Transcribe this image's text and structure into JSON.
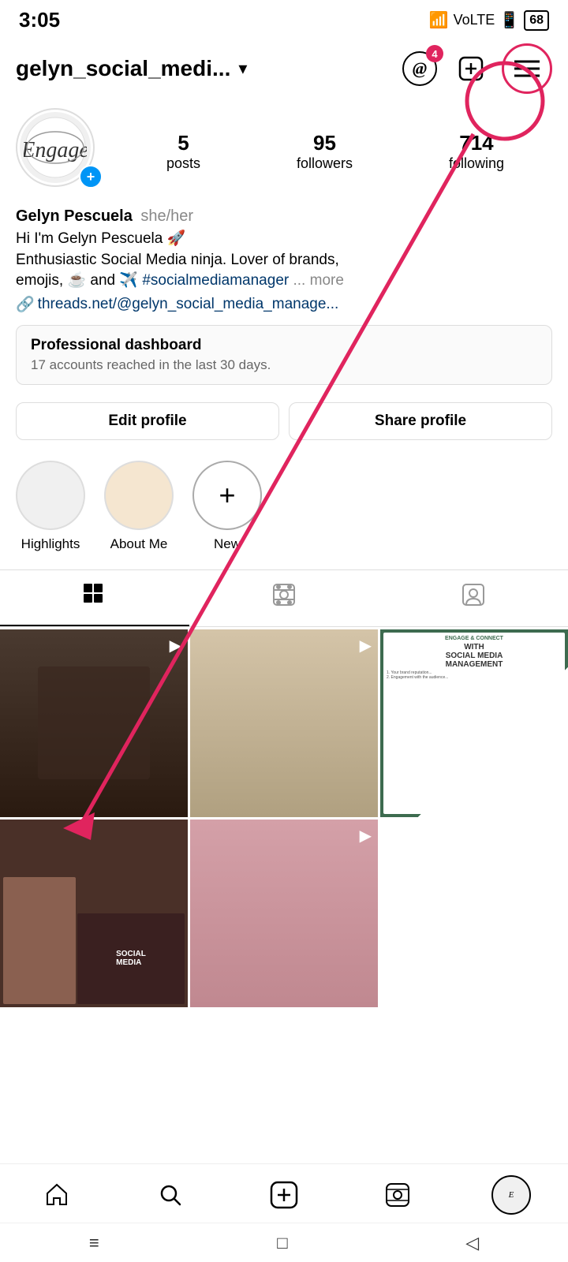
{
  "statusBar": {
    "time": "3:05",
    "batteryLevel": "68"
  },
  "header": {
    "username": "gelyn_social_medi...",
    "chevron": "▾"
  },
  "profile": {
    "displayName": "Gelyn Pescuela",
    "pronouns": "she/her",
    "bioLine1": "Hi I'm Gelyn Pescuela 🚀",
    "bioLine2": "Enthusiastic Social Media ninja. Lover of brands,",
    "bioLine3": "emojis, ☕ and ✈️",
    "hashtag": "#socialmediamanager",
    "bioMore": "... more",
    "link": "threads.net/@gelyn_social_media_manage...",
    "stats": {
      "posts": {
        "count": "5",
        "label": "posts"
      },
      "followers": {
        "count": "95",
        "label": "followers"
      },
      "following": {
        "count": "714",
        "label": "following"
      }
    }
  },
  "dashboard": {
    "title": "Professional dashboard",
    "subtitle": "17 accounts reached in the last 30 days."
  },
  "buttons": {
    "editProfile": "Edit profile",
    "shareProfile": "Share profile"
  },
  "highlights": [
    {
      "label": "Highlights",
      "style": "gray"
    },
    {
      "label": "About Me",
      "style": "cream"
    },
    {
      "label": "New",
      "style": "new"
    }
  ],
  "tabs": [
    {
      "label": "grid-icon",
      "active": true
    },
    {
      "label": "reel-icon",
      "active": false
    },
    {
      "label": "tagged-icon",
      "active": false
    }
  ],
  "nav": {
    "home": "⌂",
    "search": "🔍",
    "add": "⊕",
    "reels": "▶",
    "profile": "Engage"
  },
  "systemNav": {
    "menu": "≡",
    "home": "□",
    "back": "◁"
  }
}
